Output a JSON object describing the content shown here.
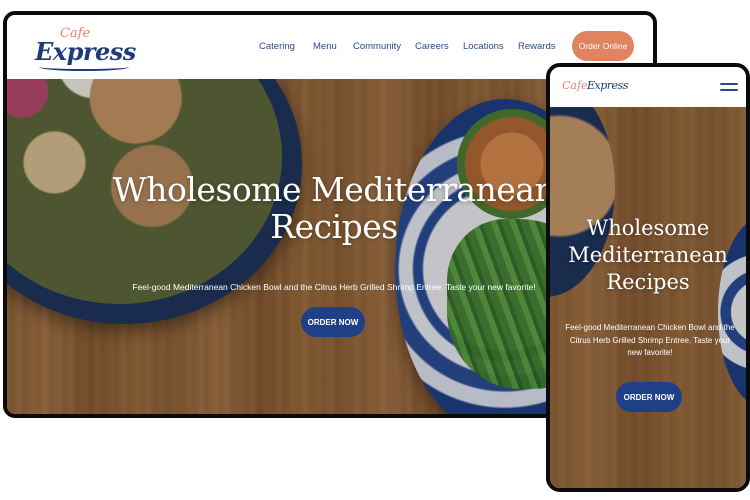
{
  "brand": {
    "cafe": "Cafe",
    "express": "Express",
    "mobile_cafe": "Cafe",
    "mobile_express": "Express"
  },
  "nav": {
    "items": [
      "Catering",
      "Menu",
      "Community",
      "Careers",
      "Locations",
      "Rewards"
    ],
    "cta": "Order Online"
  },
  "hero": {
    "title_line1": "Wholesome Mediterranean",
    "title_line2": "Recipes",
    "subtitle": "Feel-good Mediterranean Chicken Bowl and the Citrus Herb Grilled Shrimp Entree. Taste your new favorite!",
    "button": "ORDER NOW"
  },
  "mobile_hero": {
    "title_line1": "Wholesome",
    "title_line2": "Mediterranean",
    "title_line3": "Recipes",
    "subtitle": "Feel-good Mediterranean Chicken Bowl and the Citrus Herb Grilled Shrimp Entree. Taste your new favorite!",
    "button": "ORDER NOW"
  },
  "colors": {
    "brand_blue": "#1f3f86",
    "accent_coral": "#e0835f",
    "logo_coral": "#e7836b"
  },
  "icons": {
    "menu": "hamburger-menu-icon"
  }
}
